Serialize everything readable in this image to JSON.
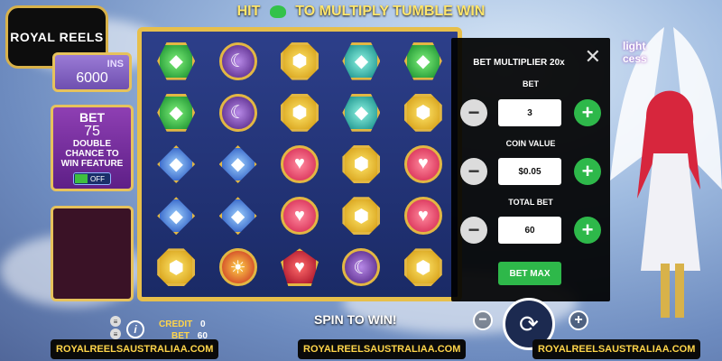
{
  "brand": {
    "logo_text": "ROYAL REELS"
  },
  "banner": {
    "text_left": "HIT",
    "text_right": "TO MULTIPLY TUMBLE WIN"
  },
  "left_panel": {
    "wins_label": "INS",
    "wins_value": "6000",
    "bet_title": "BET",
    "bet_value": "75",
    "line1": "DOUBLE",
    "line2": "CHANCE TO",
    "line3": "WIN FEATURE",
    "toggle_state": "OFF"
  },
  "reels": {
    "symbols": [
      [
        "green",
        "purple",
        "yellow",
        "teal",
        "green"
      ],
      [
        "green",
        "purple",
        "yellow",
        "teal",
        "yellow"
      ],
      [
        "blue",
        "blue",
        "pink",
        "yellow",
        "pink"
      ],
      [
        "blue",
        "blue",
        "pink",
        "yellow",
        "pink"
      ],
      [
        "yellow",
        "sun",
        "red",
        "purple",
        "yellow"
      ]
    ]
  },
  "bet_panel": {
    "title": "BET MULTIPLIER 20x",
    "close_icon": "close-icon",
    "bet_label": "BET",
    "bet_value": "3",
    "coin_label": "COIN VALUE",
    "coin_value": "$0.05",
    "total_label": "TOTAL BET",
    "total_value": "60",
    "bet_max_label": "BET MAX"
  },
  "character_title": {
    "line1": "light",
    "line2": "cess"
  },
  "footer": {
    "credit_label": "CREDIT",
    "credit_value": "0",
    "bet_label": "BET",
    "bet_value": "60",
    "spin_text": "SPIN TO WIN!",
    "minus": "−",
    "plus": "+",
    "spin_icon": "refresh-icon"
  },
  "watermarks": [
    "ROYALREELSAUSTRALIAA.COM",
    "ROYALREELSAUSTRALIAA.COM",
    "ROYALREELSAUSTRALIAA.COM"
  ],
  "colors": {
    "frame_gold": "#e7bf4b",
    "accent_green": "#2eb84a",
    "watermark_text": "#ffd54a"
  }
}
